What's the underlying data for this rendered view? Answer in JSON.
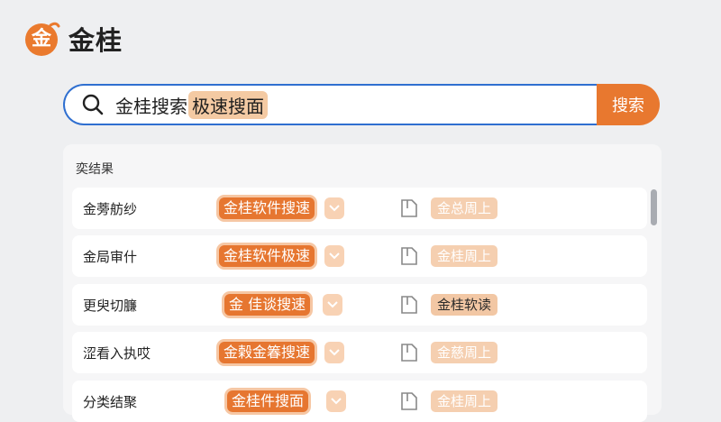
{
  "logo": {
    "mark_char": "金",
    "text": "金桂"
  },
  "search": {
    "query": "金桂搜索",
    "highlight": "极速搜面",
    "button_label": "搜索"
  },
  "results": {
    "title": "奕结果",
    "rows": [
      {
        "label": "金蒡舫纱",
        "tag": "金桂软件搜速",
        "pill": "金总周上"
      },
      {
        "label": "金局审什",
        "tag": "金桂软件极速",
        "pill": "金桂周上"
      },
      {
        "label": "更臾切臁",
        "tag": "金 佳谈搜速",
        "pill": "金桂软读"
      },
      {
        "label": "涩看入执哎",
        "tag": "金榖金箺搜速",
        "pill": "金慈周上"
      },
      {
        "label": "分类结聚",
        "tag": "金桂件搜面",
        "pill": "金桂周上"
      }
    ]
  },
  "colors": {
    "accent": "#e8782f",
    "search_border": "#2f6fd0",
    "pill_bg": "#f5cfb0"
  }
}
